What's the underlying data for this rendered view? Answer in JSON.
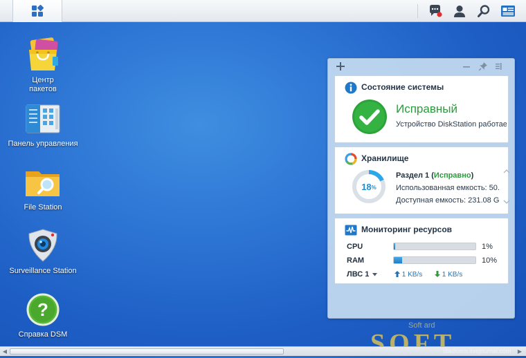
{
  "desktop": {
    "icons": [
      {
        "label": "Центр\nпакетов"
      },
      {
        "label": "Панель управления"
      },
      {
        "label": "File Station"
      },
      {
        "label": "Surveillance Station"
      },
      {
        "label": "Справка DSM"
      }
    ]
  },
  "system_status": {
    "title": "Состояние системы",
    "status": "Исправный",
    "description": "Устройство DiskStation работает нормально."
  },
  "storage": {
    "title": "Хранилище",
    "percent_value": "18",
    "percent_sign": "%",
    "used_fraction": 0.18,
    "volume_label": "Раздел 1",
    "volume_status": "Исправно",
    "used_capacity": "Использованная емкость: 50.",
    "free_capacity": "Доступная емкость: 231.08 G"
  },
  "resource_monitor": {
    "title": "Мониторинг ресурсов",
    "cpu": {
      "label": "CPU",
      "value": "1%",
      "fraction": 0.01
    },
    "ram": {
      "label": "RAM",
      "value": "10%",
      "fraction": 0.1
    },
    "lan_label": "ЛВС 1",
    "upload": "1 KB/s",
    "download": "1 KB/s"
  },
  "watermark": {
    "main": "SOFT",
    "small": "Soft ard",
    "url": "stadiums.livejournal.com"
  },
  "colors": {
    "ok_green": "#2b9a3c",
    "accent_blue": "#1e8fd3",
    "storage_ring": "#d9e0e7"
  }
}
